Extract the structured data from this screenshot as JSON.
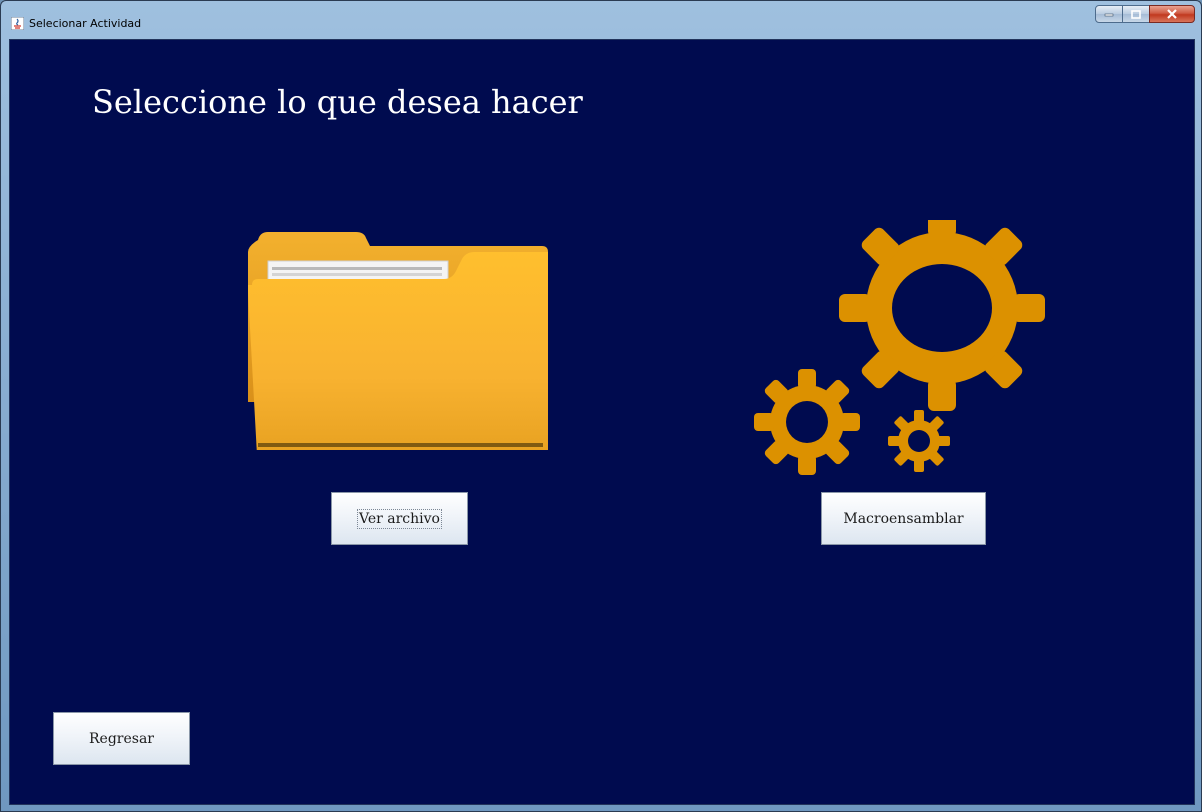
{
  "window": {
    "title": "Selecionar Actividad"
  },
  "main": {
    "heading": "Seleccione lo que desea hacer",
    "view_file_label": "Ver archivo",
    "macro_label": "Macroensamblar",
    "back_label": "Regresar"
  },
  "colors": {
    "background": "#000b4f",
    "accent_gold": "#dc9100",
    "folder_gold": "#f6b52a"
  },
  "icons": [
    "java-app-icon",
    "minimize-icon",
    "maximize-icon",
    "close-icon",
    "folder-icon",
    "gears-icon"
  ]
}
